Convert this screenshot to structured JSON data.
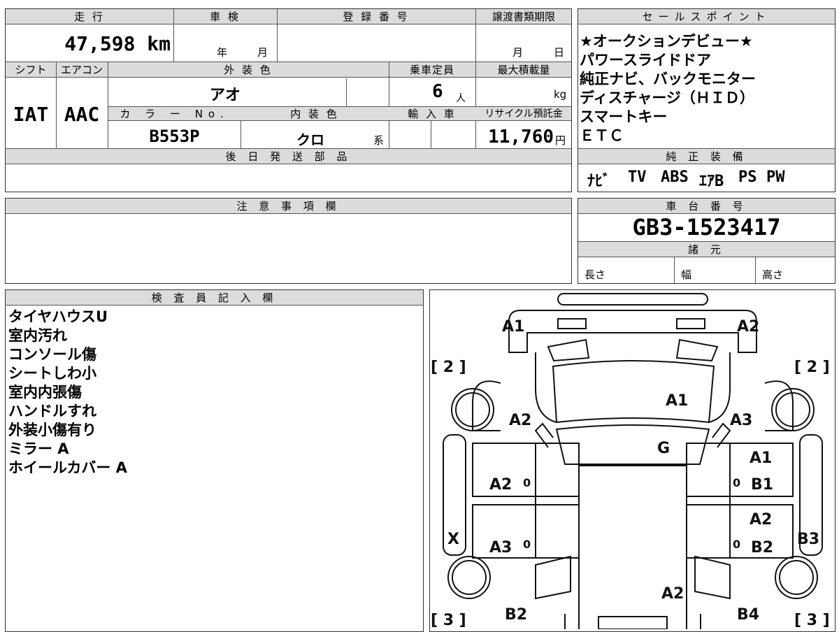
{
  "main": {
    "mileage_label": "走 行",
    "mileage": "47,598 km",
    "inspection_label": "車 検",
    "inspection_year": "年",
    "inspection_month": "月",
    "registration_label": "登 録 番 号",
    "transfer_deadline_label": "譲渡書類期限",
    "transfer_month": "月",
    "transfer_day": "日",
    "shift_label": "シフト",
    "shift": "IAT",
    "ac_label": "エアコン",
    "ac": "AAC",
    "exterior_color_label": "外 装 色",
    "exterior_color": "アオ",
    "capacity_label": "乗車定員",
    "capacity": "6",
    "capacity_unit": "人",
    "max_load_label": "最大積載量",
    "max_load_unit": "kg",
    "color_no_label": "カ ラ ー No.",
    "color_no": "B553P",
    "interior_color_label": "内 装 色",
    "interior_color": "クロ",
    "interior_suffix": "系",
    "import_label": "輸 入 車",
    "recycle_label": "リサイクル預託金",
    "recycle_fee": "11,760",
    "recycle_unit": "円",
    "later_parts_label": "後 日 発 送 部 品"
  },
  "sales_points": {
    "label": "セールスポイント",
    "items": [
      "★オークションデビュー★",
      "パワースライドドア",
      "純正ナビ、バックモニター",
      "ディスチャージ（ＨＩＤ）",
      "スマートキー",
      "ＥＴＣ"
    ]
  },
  "equipment": {
    "label": "純 正 装 備",
    "items": [
      "ﾅﾋﾞ",
      "TV",
      "ABS",
      "ｴｱB",
      "PS",
      "PW"
    ]
  },
  "caution": {
    "label": "注 意 事 項 欄"
  },
  "chassis": {
    "label": "車 台 番 号",
    "number": "GB3-1523417"
  },
  "specs": {
    "label": "諸 元",
    "length": "長さ",
    "width": "幅",
    "height": "高さ"
  },
  "inspector": {
    "label": "検 査 員 記 入 欄",
    "notes": [
      "タイヤハウスU",
      "室内汚れ",
      "コンソール傷",
      "シートしわ小",
      "室内内張傷",
      "ハンドルすれ",
      "外装小傷有り",
      "ミラー A",
      "ホイールカバー A"
    ]
  },
  "diagram": {
    "marks": {
      "front_left": "A1",
      "front_right": "A2",
      "left_front_fender": "A2",
      "hood": "A1",
      "right_front_fender": "A3",
      "windshield": "G",
      "right_front_door_top": "A1",
      "right_front_door": "B1",
      "left_front_door": "A2",
      "left_rear_door": "A3",
      "right_rear_door_top": "A2",
      "right_rear_door": "B2",
      "left_side": "X",
      "right_side": "B3",
      "roof_rear": "A2",
      "left_rear": "B2",
      "right_rear": "B4",
      "tire_fl": "[ 2 ]",
      "tire_fr": "[ 2 ]",
      "tire_rl": "[ 3 ]",
      "tire_rr": "[ 3 ]",
      "zero": "0"
    }
  }
}
